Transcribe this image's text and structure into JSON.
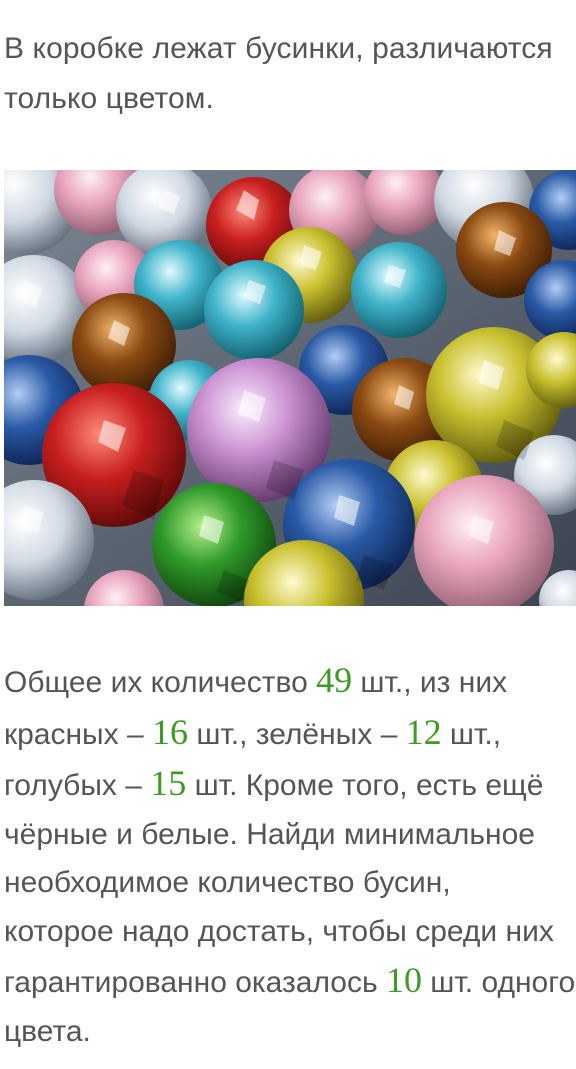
{
  "intro": {
    "line1": "В коробке лежат бусинки, различаются",
    "line2": "только цветом."
  },
  "image": {
    "subject": "crystal-beads-photo",
    "bead_colors": [
      "#c81f1f",
      "#2f9b2a",
      "#3fb3c9",
      "#2a5aa6",
      "#d4c93a",
      "#c98fd0",
      "#8a4a12",
      "#e8a4bd",
      "#eef3f7"
    ]
  },
  "problem": {
    "l1_a": "Общее их количество ",
    "total": "49",
    "l1_b": " шт., из них",
    "l2_a": "красных – ",
    "red": "16",
    "l2_b": " шт., зелёных – ",
    "green": "12",
    "l2_c": " шт.,",
    "l3_a": "голубых – ",
    "blue": "15",
    "l3_b": " шт. Кроме того, есть ещё",
    "l4": "чёрные и белые. Найди минимальное",
    "l5": "необходимое количество бусин,",
    "l6": "которое надо достать, чтобы среди них",
    "l7_a": "гарантированно оказалось ",
    "target": "10",
    "l7_b": " шт. одного",
    "l8": "цвета."
  },
  "colors": {
    "text": "#555555",
    "number_accent": "#3d9b22"
  }
}
